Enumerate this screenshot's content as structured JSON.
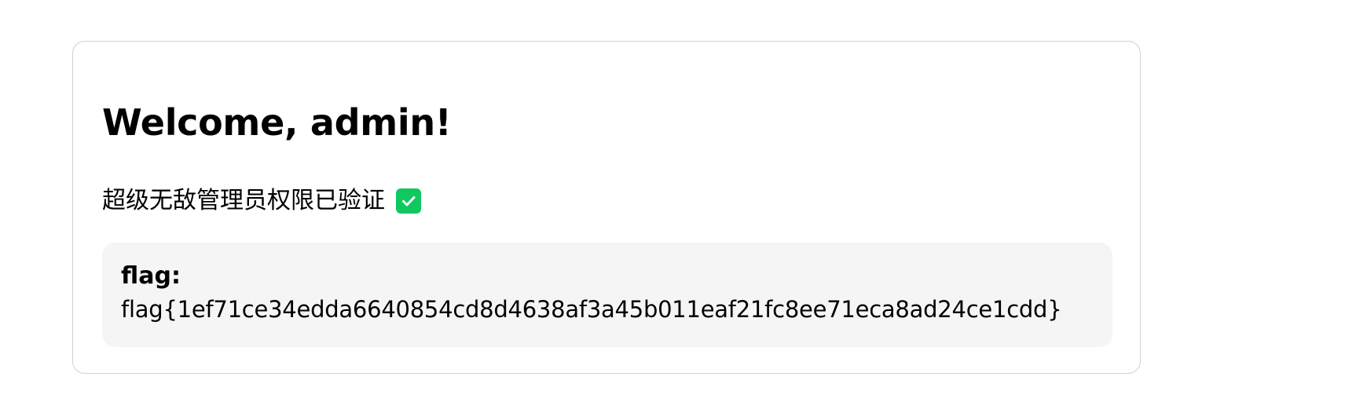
{
  "card": {
    "title": "Welcome, admin!",
    "status_text": "超级无敌管理员权限已验证",
    "status_icon": "check-mark-icon",
    "status_icon_color": "#10c85f",
    "flag_label": "flag:",
    "flag_value": "flag{1ef71ce34edda6640854cd8d4638af3a45b011eaf21fc8ee71eca8ad24ce1cdd}"
  }
}
